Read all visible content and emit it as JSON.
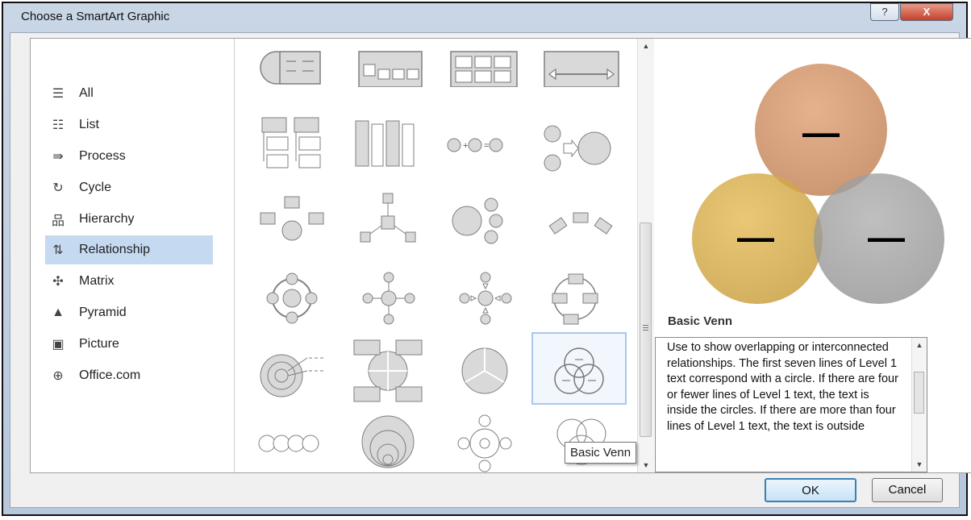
{
  "window": {
    "title": "Choose a SmartArt Graphic",
    "help_label": "?",
    "close_label": "X"
  },
  "categories": [
    {
      "label": "All",
      "icon": "all-icon",
      "glyph": "☰"
    },
    {
      "label": "List",
      "icon": "list-icon",
      "glyph": "☷"
    },
    {
      "label": "Process",
      "icon": "process-icon",
      "glyph": "⇛"
    },
    {
      "label": "Cycle",
      "icon": "cycle-icon",
      "glyph": "↻"
    },
    {
      "label": "Hierarchy",
      "icon": "hierarchy-icon",
      "glyph": "品"
    },
    {
      "label": "Relationship",
      "icon": "relationship-icon",
      "glyph": "⇅"
    },
    {
      "label": "Matrix",
      "icon": "matrix-icon",
      "glyph": "✣"
    },
    {
      "label": "Pyramid",
      "icon": "pyramid-icon",
      "glyph": "▲"
    },
    {
      "label": "Picture",
      "icon": "picture-icon",
      "glyph": "▣"
    },
    {
      "label": "Office.com",
      "icon": "globe-icon",
      "glyph": "⊕"
    }
  ],
  "selected_category": "Relationship",
  "preview": {
    "title": "Basic Venn",
    "minus_glyph": "—",
    "description": "Use to show overlapping or interconnected relationships. The first seven lines of Level 1 text correspond with a circle. If there are four or fewer lines of Level 1 text, the text is inside the circles. If there are more than four lines of Level 1 text, the text is outside",
    "colors": {
      "top": "#c58a62",
      "left": "#c79d3a",
      "right": "#8f8f8f"
    }
  },
  "tooltip": "Basic Venn",
  "buttons": {
    "ok": "OK",
    "cancel": "Cancel"
  },
  "scroll": {
    "up": "▲",
    "down": "▼"
  }
}
